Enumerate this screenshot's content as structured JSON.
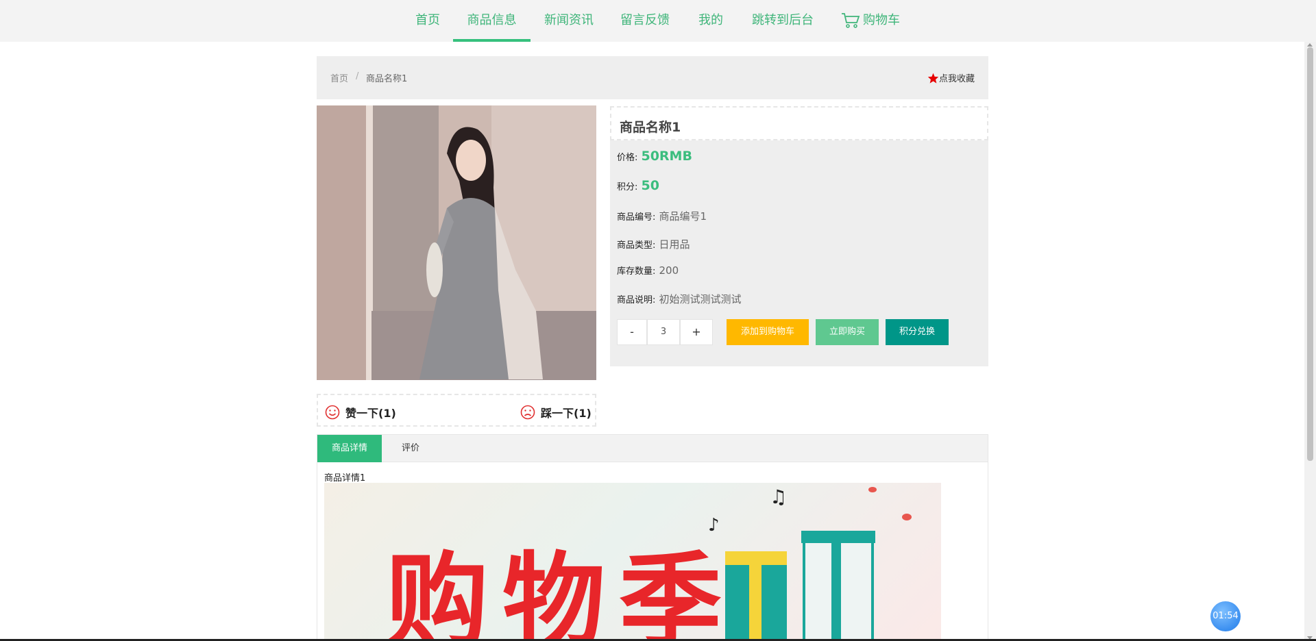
{
  "nav": {
    "items": [
      "首页",
      "商品信息",
      "新闻资讯",
      "留言反馈",
      "我的",
      "跳转到后台",
      "购物车"
    ],
    "active_index": 1
  },
  "breadcrumb": {
    "home": "首页",
    "sep": "/",
    "current": "商品名称1"
  },
  "favorite_label": "点我收藏",
  "product": {
    "name": "商品名称1",
    "price_label": "价格:",
    "price_value": "50RMB",
    "points_label": "积分:",
    "points_value": "50",
    "code_label": "商品编号:",
    "code_value": "商品编号1",
    "type_label": "商品类型:",
    "type_value": "日用品",
    "stock_label": "库存数量:",
    "stock_value": "200",
    "desc_label": "商品说明:",
    "desc_value": "初始测试测试测试"
  },
  "quantity": {
    "minus": "-",
    "value": "3",
    "plus": "+"
  },
  "buttons": {
    "add_cart": "添加到购物车",
    "buy_now": "立即购买",
    "exchange": "积分兑换"
  },
  "votes": {
    "like": "赞一下(1)",
    "dislike": "踩一下(1)"
  },
  "tabs": [
    "商品详情",
    "评价"
  ],
  "detail_text": "商品详情1",
  "banner_text": "购物季",
  "timer": "01:54",
  "colors": {
    "accent": "#3bbd7e",
    "yellow": "#ffb800",
    "teal": "#009688",
    "star": "#e60000"
  }
}
